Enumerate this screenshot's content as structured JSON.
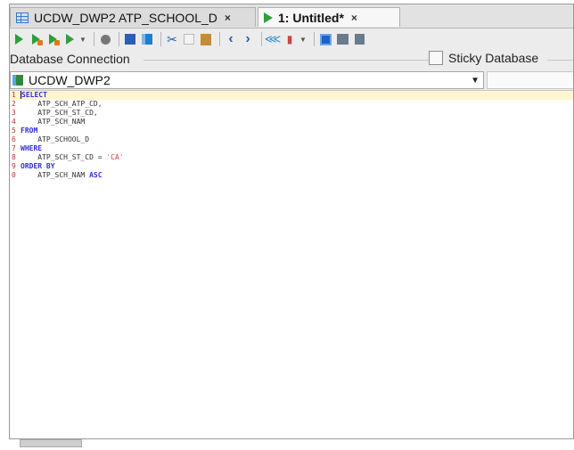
{
  "tabs": [
    {
      "label": "UCDW_DWP2 ATP_SCHOOL_D",
      "close": "×"
    },
    {
      "label": "1: Untitled*",
      "close": "×"
    }
  ],
  "connection": {
    "label": "Database Connection",
    "sticky_label": "Sticky Database",
    "selected": "UCDW_DWP2"
  },
  "editor": {
    "lines": [
      {
        "num": "1",
        "parts": [
          {
            "t": "SELECT",
            "k": "kw"
          }
        ]
      },
      {
        "num": "2",
        "parts": [
          {
            "t": "    ATP_SCH_ATP_CD,",
            "k": "id"
          }
        ]
      },
      {
        "num": "3",
        "parts": [
          {
            "t": "    ATP_SCH_ST_CD,",
            "k": "id"
          }
        ]
      },
      {
        "num": "4",
        "parts": [
          {
            "t": "    ATP_SCH_NAM",
            "k": "id"
          }
        ]
      },
      {
        "num": "5",
        "parts": [
          {
            "t": "FROM",
            "k": "kw"
          }
        ]
      },
      {
        "num": "6",
        "parts": [
          {
            "t": "    ATP_SCHOOL_D",
            "k": "id"
          }
        ]
      },
      {
        "num": "7",
        "parts": [
          {
            "t": "WHERE",
            "k": "kw"
          }
        ]
      },
      {
        "num": "8",
        "parts": [
          {
            "t": "    ATP_SCH_ST_CD = ",
            "k": "id"
          },
          {
            "t": "'CA'",
            "k": "str"
          }
        ]
      },
      {
        "num": "9",
        "parts": [
          {
            "t": "ORDER BY",
            "k": "kw"
          }
        ]
      },
      {
        "num": "0",
        "parts": [
          {
            "t": "    ATP_SCH_NAM ",
            "k": "id"
          },
          {
            "t": "ASC",
            "k": "kw"
          }
        ]
      }
    ]
  },
  "colors": {
    "accent_blue": "#2f2fd8",
    "line_number_red": "#c03030",
    "current_line": "#fff6cf"
  }
}
